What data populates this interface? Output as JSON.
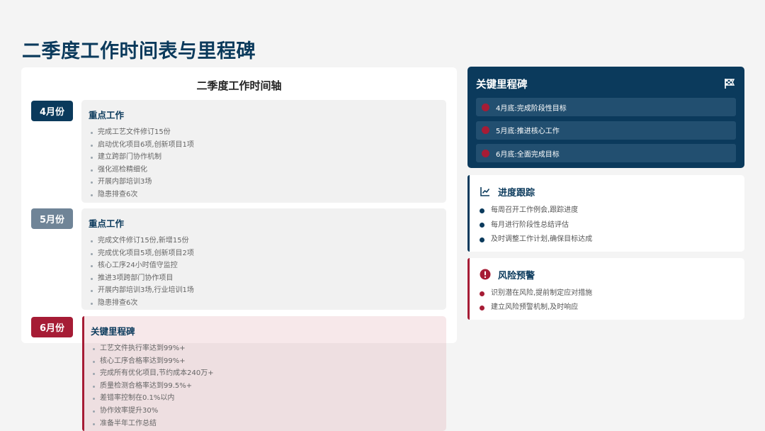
{
  "page": {
    "title": "二季度工作时间表与里程碑"
  },
  "timeline": {
    "title": "二季度工作时间轴",
    "months": [
      {
        "label": "4月份",
        "heading": "重点工作",
        "items": [
          "完成工艺文件修订15份",
          "启动优化项目6项,创新项目1项",
          "建立跨部门协作机制",
          "强化巡检精细化",
          "开展内部培训3场",
          "隐患排查6次"
        ]
      },
      {
        "label": "5月份",
        "heading": "重点工作",
        "items": [
          "完成文件修订15份,新增15份",
          "完成优化项目5项,创新项目2项",
          "核心工序24小时值守监控",
          "推进3项跨部门协作项目",
          "开展内部培训3场,行业培训1场",
          "隐患排查6次"
        ]
      },
      {
        "label": "6月份",
        "heading": "关键里程碑",
        "items": [
          "工艺文件执行率达到99%+",
          "核心工序合格率达到99%+",
          "完成所有优化项目,节约成本240万+",
          "质量检测合格率达到99.5%+",
          "差错率控制在0.1%以内",
          "协作效率提升30%",
          "准备半年工作总结"
        ]
      }
    ]
  },
  "milestones": {
    "title": "关键里程碑",
    "icon": "flag-icon",
    "items": [
      "4月底:完成阶段性目标",
      "5月底:推进核心工作",
      "6月底:全面完成目标"
    ]
  },
  "progress": {
    "title": "进度跟踪",
    "icon": "line-chart-icon",
    "items": [
      "每周召开工作例会,跟踪进度",
      "每月进行阶段性总结评估",
      "及时调整工作计划,确保目标达成"
    ]
  },
  "risk": {
    "title": "风险预警",
    "icon": "alert-icon",
    "items": [
      "识别潜在风险,提前制定应对措施",
      "建立风险预警机制,及时响应"
    ]
  },
  "colors": {
    "navy": "#0b3a5c",
    "crimson": "#a61c35",
    "slate": "#6f8497"
  }
}
